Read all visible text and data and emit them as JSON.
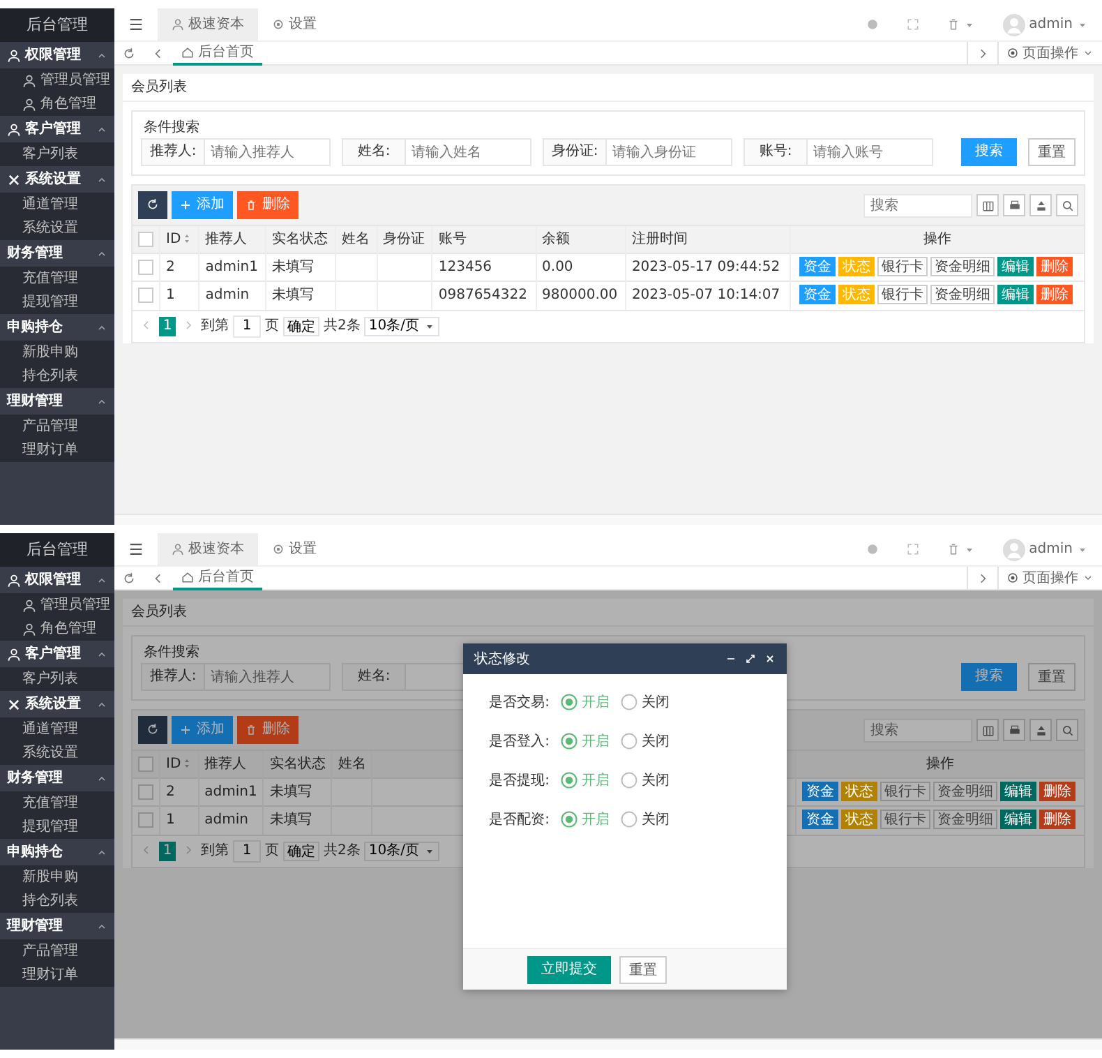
{
  "screens": [
    {
      "sidebar": {
        "title": "后台管理",
        "groups": [
          {
            "label": "权限管理",
            "expanded": true,
            "items": [
              {
                "label": "管理员管理"
              },
              {
                "label": "角色管理"
              }
            ]
          },
          {
            "label": "客户管理",
            "expanded": true,
            "items": [
              {
                "label": "客户列表"
              }
            ]
          },
          {
            "label": "系统设置",
            "expanded": true,
            "items": [
              {
                "label": "通道管理"
              },
              {
                "label": "系统设置"
              }
            ]
          },
          {
            "label": "财务管理",
            "expanded": true,
            "items": [
              {
                "label": "充值管理"
              },
              {
                "label": "提现管理"
              }
            ]
          },
          {
            "label": "申购持仓",
            "expanded": true,
            "items": [
              {
                "label": "新股申购"
              },
              {
                "label": "持仓列表"
              }
            ]
          },
          {
            "label": "理财管理",
            "expanded": true,
            "items": [
              {
                "label": "产品管理"
              },
              {
                "label": "理财订单"
              }
            ]
          }
        ]
      },
      "header": {
        "tabs": [
          {
            "label": "极速资本",
            "selected": true
          },
          {
            "label": "设置",
            "selected": false
          }
        ],
        "user": "admin"
      },
      "page_tabs": [
        {
          "label": "后台首页",
          "selected": true
        }
      ],
      "page_menu": "页面操作",
      "panel": {
        "title": "会员列表",
        "search": {
          "legend": "条件搜索",
          "fields": [
            {
              "label": "推荐人:",
              "placeholder": "请输入推荐人"
            },
            {
              "label": "姓名:",
              "placeholder": "请输入姓名"
            },
            {
              "label": "身份证:",
              "placeholder": "请输入身份证"
            },
            {
              "label": "账号:",
              "placeholder": "请输入账号"
            }
          ],
          "search_button": "搜索",
          "reset_button": "重置"
        },
        "toolbar": {
          "add": "添加",
          "delete": "删除",
          "search_placeholder": "搜索"
        },
        "table": {
          "select_all_checked": false,
          "columns": [
            "ID",
            "推荐人",
            "实名状态",
            "姓名",
            "身份证",
            "账号",
            "余额",
            "注册时间",
            "操作"
          ],
          "rows": [
            {
              "checked": false,
              "cells": [
                "2",
                "admin1",
                "未填写",
                null,
                null,
                "123456",
                "0.00",
                "2023-05-17 09:44:52"
              ],
              "actions": [
                {
                  "label": "资金",
                  "kind": "solid",
                  "color": "#1e9fff"
                },
                {
                  "label": "状态",
                  "kind": "solid",
                  "color": "#ffb800"
                },
                {
                  "label": "银行卡",
                  "kind": "outline",
                  "color": "#ffffff"
                },
                {
                  "label": "资金明细",
                  "kind": "outline",
                  "color": "#ffffff"
                },
                {
                  "label": "编辑",
                  "kind": "solid",
                  "color": "#009688"
                },
                {
                  "label": "删除",
                  "kind": "solid",
                  "color": "#ff5722"
                }
              ]
            },
            {
              "checked": false,
              "cells": [
                "1",
                "admin",
                "未填写",
                null,
                null,
                "0987654322",
                "980000.00",
                "2023-05-07 10:14:07"
              ],
              "actions": [
                {
                  "label": "资金",
                  "kind": "solid",
                  "color": "#1e9fff"
                },
                {
                  "label": "状态",
                  "kind": "solid",
                  "color": "#ffb800"
                },
                {
                  "label": "银行卡",
                  "kind": "outline",
                  "color": "#ffffff"
                },
                {
                  "label": "资金明细",
                  "kind": "outline",
                  "color": "#ffffff"
                },
                {
                  "label": "编辑",
                  "kind": "solid",
                  "color": "#009688"
                },
                {
                  "label": "删除",
                  "kind": "solid",
                  "color": "#ff5722"
                }
              ]
            }
          ]
        },
        "pagination": {
          "pages": [
            {
              "label": "1",
              "selected": true
            }
          ],
          "goto": "到第",
          "page_input": "1",
          "page_unit": "页",
          "confirm": "确定",
          "total": "共2条",
          "per_page": "10条/页"
        }
      }
    },
    {
      "sidebar": {
        "title": "后台管理",
        "groups": [
          {
            "label": "权限管理",
            "expanded": true,
            "items": [
              {
                "label": "管理员管理"
              },
              {
                "label": "角色管理"
              }
            ]
          },
          {
            "label": "客户管理",
            "expanded": true,
            "items": [
              {
                "label": "客户列表"
              }
            ]
          },
          {
            "label": "系统设置",
            "expanded": true,
            "items": [
              {
                "label": "通道管理"
              },
              {
                "label": "系统设置"
              }
            ]
          },
          {
            "label": "财务管理",
            "expanded": true,
            "items": [
              {
                "label": "充值管理"
              },
              {
                "label": "提现管理"
              }
            ]
          },
          {
            "label": "申购持仓",
            "expanded": true,
            "items": [
              {
                "label": "新股申购"
              },
              {
                "label": "持仓列表"
              }
            ]
          },
          {
            "label": "理财管理",
            "expanded": true,
            "items": [
              {
                "label": "产品管理"
              },
              {
                "label": "理财订单"
              }
            ]
          }
        ]
      },
      "header": {
        "tabs": [
          {
            "label": "极速资本",
            "selected": true
          },
          {
            "label": "设置",
            "selected": false
          }
        ],
        "user": "admin"
      },
      "page_tabs": [
        {
          "label": "后台首页",
          "selected": true
        }
      ],
      "page_menu": "页面操作",
      "panel": {
        "title": "会员列表",
        "search": {
          "legend": "条件搜索",
          "fields": [
            {
              "label": "推荐人:",
              "placeholder": "请输入推荐人"
            },
            {
              "label": "姓名:"
            }
          ],
          "search_button": "搜索",
          "reset_button": "重置"
        },
        "toolbar": {
          "add": "添加",
          "delete": "删除",
          "search_placeholder": "搜索"
        },
        "table": {
          "select_all_checked": false,
          "columns": [
            "ID",
            "推荐人",
            "实名状态",
            "姓名",
            "操作"
          ],
          "rows": [
            {
              "checked": false,
              "cells": [
                "2",
                "admin1",
                "未填写",
                null
              ],
              "actions": [
                {
                  "label": "资金",
                  "kind": "solid",
                  "color": "#156fb3"
                },
                {
                  "label": "状态",
                  "kind": "solid",
                  "color": "#b38100"
                },
                {
                  "label": "银行卡",
                  "kind": "outline",
                  "color": "#b3b3b3"
                },
                {
                  "label": "资金明细",
                  "kind": "outline",
                  "color": "#b3b3b3"
                },
                {
                  "label": "编辑",
                  "kind": "solid",
                  "color": "#00695f"
                },
                {
                  "label": "删除",
                  "kind": "solid",
                  "color": "#b33d18"
                }
              ]
            },
            {
              "checked": false,
              "cells": [
                "1",
                "admin",
                "未填写",
                null
              ],
              "actions": [
                {
                  "label": "资金",
                  "kind": "solid",
                  "color": "#156fb3"
                },
                {
                  "label": "状态",
                  "kind": "solid",
                  "color": "#b38100"
                },
                {
                  "label": "银行卡",
                  "kind": "outline",
                  "color": "#b3b3b3"
                },
                {
                  "label": "资金明细",
                  "kind": "outline",
                  "color": "#b3b3b3"
                },
                {
                  "label": "编辑",
                  "kind": "solid",
                  "color": "#00695f"
                },
                {
                  "label": "删除",
                  "kind": "solid",
                  "color": "#b33d18"
                }
              ]
            }
          ]
        },
        "pagination": {
          "pages": [
            {
              "label": "1",
              "selected": true
            }
          ],
          "goto": "到第",
          "page_input": "1",
          "page_unit": "页",
          "confirm": "确定",
          "total": "共2条",
          "per_page": "10条/页"
        }
      },
      "modal": {
        "title": "状态修改",
        "rows": [
          {
            "label": "是否交易:",
            "options": [
              {
                "label": "开启",
                "selected": true
              },
              {
                "label": "关闭",
                "selected": false
              }
            ]
          },
          {
            "label": "是否登入:",
            "options": [
              {
                "label": "开启",
                "selected": true
              },
              {
                "label": "关闭",
                "selected": false
              }
            ]
          },
          {
            "label": "是否提现:",
            "options": [
              {
                "label": "开启",
                "selected": true
              },
              {
                "label": "关闭",
                "selected": false
              }
            ]
          },
          {
            "label": "是否配资:",
            "options": [
              {
                "label": "开启",
                "selected": true
              },
              {
                "label": "关闭",
                "selected": false
              }
            ]
          }
        ],
        "submit": "立即提交",
        "reset": "重置"
      }
    }
  ]
}
